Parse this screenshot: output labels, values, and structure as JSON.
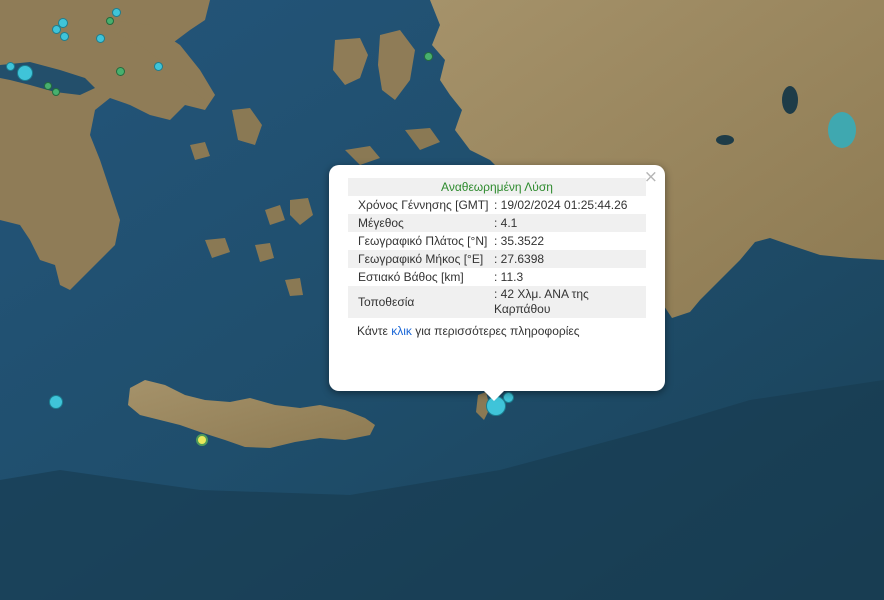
{
  "popup": {
    "title": "Αναθεωρημένη Λύση",
    "close": "×",
    "rows": [
      {
        "label": "Χρόνος Γέννησης [GMT]",
        "value": ": 19/02/2024 01:25:44.26"
      },
      {
        "label": "Μέγεθος",
        "value": ": 4.1"
      },
      {
        "label": "Γεωγραφικό Πλάτος [°N]",
        "value": ": 35.3522"
      },
      {
        "label": "Γεωγραφικό Μήκος [°E]",
        "value": ": 27.6398"
      },
      {
        "label": "Εστιακό Βάθος [km]",
        "value": ": 11.3"
      },
      {
        "label": "Τοποθεσία",
        "value": ": 42 Χλμ. ΑΝΑ της Καρπάθου"
      }
    ],
    "more_prefix": "Κάντε ",
    "more_link": "κλικ",
    "more_suffix": " για περισσότερες πληροφορίες"
  },
  "colors": {
    "sea": "#1d4a66",
    "land": "#9a8660",
    "marker_cyan": "#3fc4d9",
    "marker_green": "#47b06e",
    "marker_yellow": "#e8e85a",
    "title_green": "#2e8b2e",
    "link_blue": "#1a66d6"
  }
}
